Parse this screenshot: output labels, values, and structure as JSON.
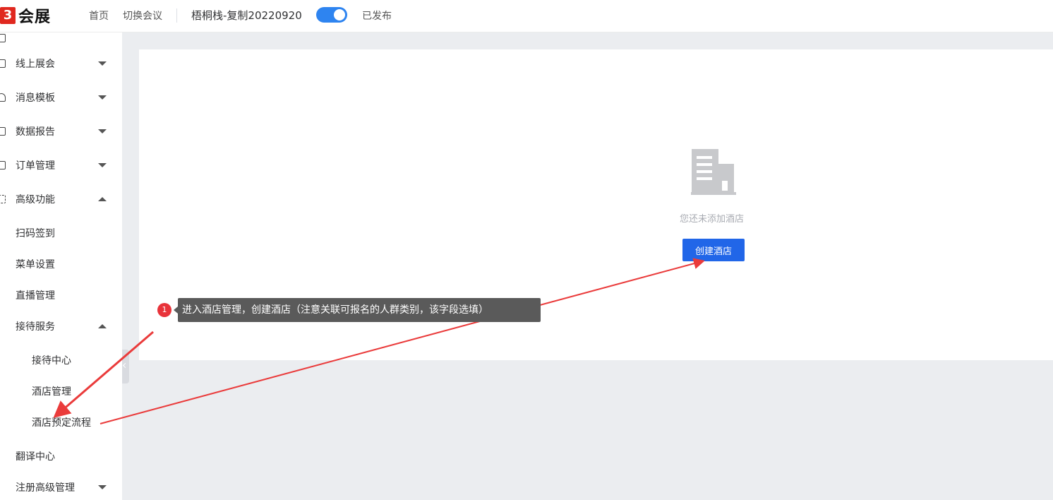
{
  "header": {
    "logo_mark": "3",
    "logo_text": "会展",
    "nav": [
      "首页",
      "切换会议"
    ],
    "conference_title": "梧桐栈-复制20220920",
    "publish_toggle_on": true,
    "publish_status": "已发布"
  },
  "sidebar": {
    "items": [
      {
        "label": "线上展会",
        "icon": "monitor-icon",
        "expanded": false
      },
      {
        "label": "消息模板",
        "icon": "bell-icon",
        "expanded": false
      },
      {
        "label": "数据报告",
        "icon": "report-icon",
        "expanded": false
      },
      {
        "label": "订单管理",
        "icon": "order-icon",
        "expanded": false
      },
      {
        "label": "高级功能",
        "icon": "grid-icon",
        "expanded": true
      },
      {
        "label": "扫码签到"
      },
      {
        "label": "菜单设置"
      },
      {
        "label": "直播管理"
      },
      {
        "label": "接待服务",
        "expanded": true
      },
      {
        "label": "接待中心"
      },
      {
        "label": "酒店管理"
      },
      {
        "label": "酒店预定流程"
      },
      {
        "label": "翻译中心"
      },
      {
        "label": "注册高级管理",
        "expanded": false
      }
    ]
  },
  "main": {
    "empty_text": "您还未添加酒店",
    "create_button": "创建酒店"
  },
  "annotation": {
    "step": "1",
    "text": "进入酒店管理，创建酒店（注意关联可报名的人群类别，该字段选填）"
  },
  "colors": {
    "accent": "#2166e8",
    "toggle": "#2e84f0",
    "annotation_red": "#e8333a"
  }
}
